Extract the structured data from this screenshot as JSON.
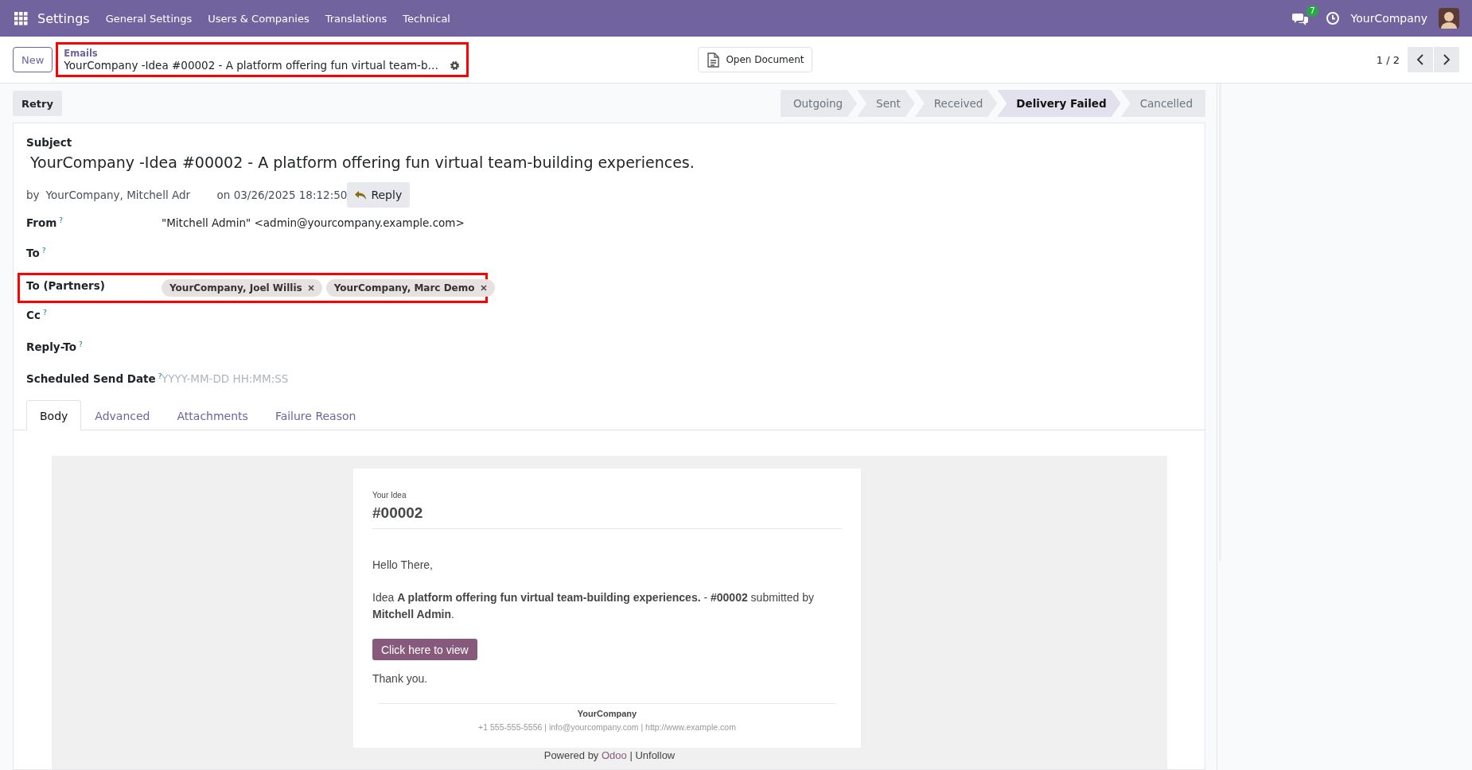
{
  "navbar": {
    "app": "Settings",
    "menu": [
      "General Settings",
      "Users & Companies",
      "Translations",
      "Technical"
    ],
    "messages_count": "7",
    "company": "YourCompany"
  },
  "control_panel": {
    "new_button": "New",
    "breadcrumb": {
      "parent": "Emails",
      "current": "YourCompany -Idea #00002 - A platform offering fun virtual team-b…",
      "highlighted": true
    },
    "open_document": "Open Document",
    "pager": "1 / 2"
  },
  "actions": {
    "retry": "Retry"
  },
  "statusbar": [
    {
      "label": "Outgoing",
      "selected": false
    },
    {
      "label": "Sent",
      "selected": false
    },
    {
      "label": "Received",
      "selected": false
    },
    {
      "label": "Delivery Failed",
      "selected": true
    },
    {
      "label": "Cancelled",
      "selected": false
    }
  ],
  "form": {
    "subject_label": "Subject",
    "subject": "YourCompany -Idea  #00002 - A platform offering fun virtual team-building experiences.",
    "by_prefix": "by",
    "author": "YourCompany, Mitchell Adr",
    "date": "on 03/26/2025 18:12:50",
    "reply_button": "Reply",
    "fields": [
      {
        "label": "From",
        "help": "?",
        "kind": "text",
        "value": "\"Mitchell Admin\" <admin@yourcompany.example.com>"
      },
      {
        "label": "To",
        "help": "?",
        "kind": "empty"
      },
      {
        "label": "To (Partners)",
        "kind": "tags",
        "highlighted": true,
        "tags": [
          "YourCompany, Joel Willis",
          "YourCompany, Marc Demo"
        ]
      },
      {
        "label": "Cc",
        "help": "?",
        "kind": "empty"
      },
      {
        "label": "Reply-To",
        "help": "?",
        "kind": "empty"
      },
      {
        "label": "Scheduled Send Date",
        "help": "?",
        "kind": "input",
        "placeholder": "YYYY-MM-DD HH:MM:SS"
      }
    ],
    "tabs": [
      {
        "label": "Body",
        "selected": true
      },
      {
        "label": "Advanced",
        "selected": false
      },
      {
        "label": "Attachments",
        "selected": false
      },
      {
        "label": "Failure Reason",
        "selected": false
      }
    ],
    "email": {
      "eyebrow": "Your Idea",
      "title": "#00002",
      "greeting": "Hello There,",
      "message": "Idea **A platform offering fun virtual team-building experiences.** - **#00002** submitted by **Mitchell Admin**.",
      "button": "Click here to view",
      "closing": "Thank you.",
      "company": "YourCompany",
      "contact": "+1 555-555-5556 | info@yourcompany.com | http://www.example.com",
      "powered_prefix": "Powered by",
      "powered_link": "Odoo",
      "powered_suffix": "| Unfollow"
    }
  }
}
